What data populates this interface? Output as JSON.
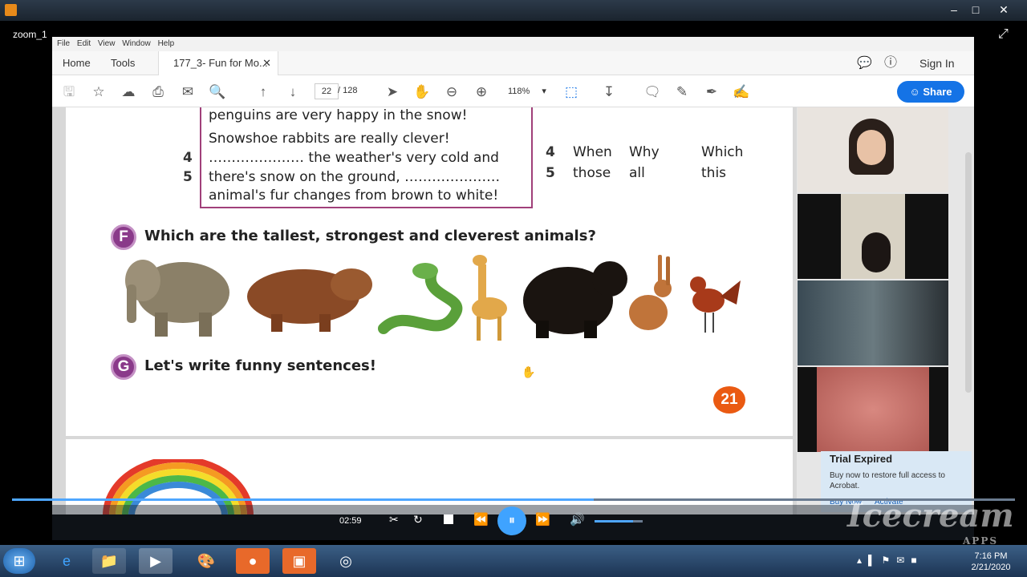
{
  "player": {
    "window_label": "zoom_1",
    "time": "02:59",
    "progress_fraction": 0.58,
    "volume_fraction": 0.8,
    "brand": "Icecream",
    "brand_sub": "APPS"
  },
  "acrobat": {
    "menu": [
      "File",
      "Edit",
      "View",
      "Window",
      "Help"
    ],
    "tabs": {
      "home": "Home",
      "tools": "Tools",
      "document": "177_3- Fun for Mo..."
    },
    "sign_in": "Sign In",
    "share": "Share",
    "page_current": "22",
    "page_total": "/ 128",
    "zoom": "118%"
  },
  "document": {
    "story_lines": [
      "penguins are very happy in the snow!",
      "Snowshoe rabbits are really clever!",
      "………………… the weather's very cold and",
      "there's snow on the ground, …………………",
      "animal's fur changes from brown to white!"
    ],
    "line_numbers": [
      "4",
      "5"
    ],
    "answer_rows": [
      {
        "num": "4",
        "words": [
          "When",
          "Why",
          "Which"
        ]
      },
      {
        "num": "5",
        "words": [
          "those",
          "all",
          "this"
        ]
      }
    ],
    "section_f": {
      "letter": "F",
      "title": "Which are the tallest, strongest and cleverest animals?"
    },
    "section_g": {
      "letter": "G",
      "title": "Let's write funny sentences!"
    },
    "page_number": "21"
  },
  "trial": {
    "title": "Trial Expired",
    "body": "Buy now to restore full access to Acrobat.",
    "buy_now": "Buy Now",
    "activate": "Activate"
  },
  "taskbar": {
    "time": "7:16 PM",
    "date": "2/21/2020"
  },
  "colors": {
    "share_blue": "#1473e6",
    "badge_purple": "#8a3a8a",
    "page_badge_orange": "#ea5a12"
  }
}
